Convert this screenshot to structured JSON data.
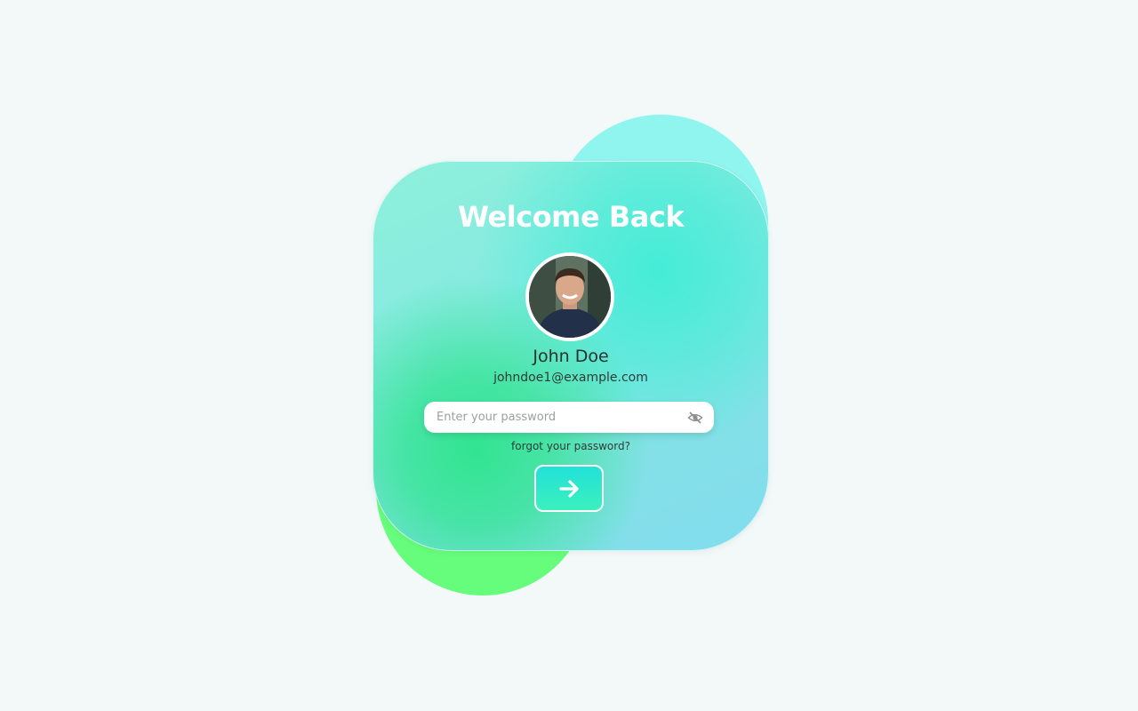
{
  "login": {
    "title": "Welcome Back",
    "user_name": "John Doe",
    "user_email": "johndoe1@example.com",
    "password_placeholder": "Enter your password",
    "password_value": "",
    "forgot_label": "forgot your password?",
    "submit_icon": "arrow-right-icon",
    "toggle_icon": "eye-off-icon"
  },
  "colors": {
    "background": "#f3f8f8",
    "blob_cyan": "#8ff5ee",
    "blob_green": "#66fd7c",
    "accent": "#22e1d9"
  }
}
